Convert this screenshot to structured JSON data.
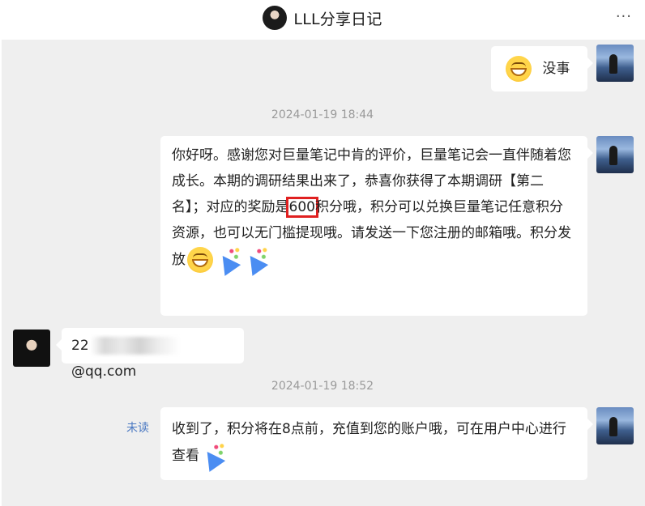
{
  "header": {
    "title": "LLL分享日记",
    "more": "···"
  },
  "messages": [
    {
      "type": "text",
      "side": "right",
      "text": "没事"
    },
    {
      "type": "time",
      "text": "2024-01-19 18:44"
    },
    {
      "type": "text",
      "side": "right",
      "seg1": "你好呀。感谢您对巨量笔记中肯的评价，巨量笔记会一直伴随着您成长。本期的调研结果出来了，恭喜你获得了本期调研【第二名】；对应的奖励是",
      "points": "600",
      "seg2": "积分哦，积分可以兑换巨量笔记任意积分资源，也可以无门槛提现哦。请发送一下您注册的邮箱哦。积分发放"
    },
    {
      "type": "text",
      "side": "left",
      "prefix": "22",
      "suffix": "@qq.com"
    },
    {
      "type": "time",
      "text": "2024-01-19 18:52"
    },
    {
      "type": "text",
      "side": "right",
      "status": "未读",
      "text": "收到了，积分将在8点前，充值到您的账户哦，可在用户中心进行查看"
    }
  ],
  "icons": {
    "grin": "grinning-face-icon",
    "party": "party-popper-icon",
    "more": "more-icon"
  }
}
